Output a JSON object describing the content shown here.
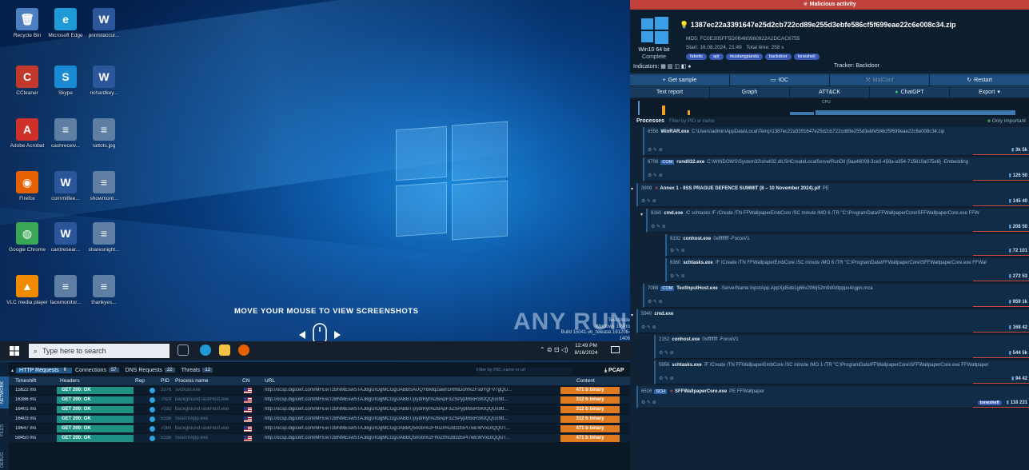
{
  "desktop": {
    "icons": [
      {
        "label": "Recycle Bin",
        "color": "#4b7fbf",
        "glyph": "🗑"
      },
      {
        "label": "Microsoft Edge",
        "color": "#1f9ad6",
        "glyph": "e"
      },
      {
        "label": "printstaccur...",
        "color": "#2b579a",
        "glyph": "W"
      },
      {
        "label": "CCleaner",
        "color": "#c0392b",
        "glyph": "C"
      },
      {
        "label": "Skype",
        "color": "#1a8ad4",
        "glyph": "S"
      },
      {
        "label": "richardkey...",
        "color": "#2b579a",
        "glyph": "W"
      },
      {
        "label": "Adobe Acrobat",
        "color": "#d0302a",
        "glyph": "A"
      },
      {
        "label": "cashreceiv...",
        "color": "#5e7ea3",
        "glyph": "≡"
      },
      {
        "label": "rattots.jpg",
        "color": "#5e7ea3",
        "glyph": "≡"
      },
      {
        "label": "Firefox",
        "color": "#e66000",
        "glyph": "◉"
      },
      {
        "label": "commitfee...",
        "color": "#2b579a",
        "glyph": "W"
      },
      {
        "label": "showmont...",
        "color": "#5e7ea3",
        "glyph": "≡"
      },
      {
        "label": "Google Chrome",
        "color": "#3aa757",
        "glyph": "◍"
      },
      {
        "label": "cardresear...",
        "color": "#2b579a",
        "glyph": "W"
      },
      {
        "label": "sharesnight...",
        "color": "#5e7ea3",
        "glyph": "≡"
      },
      {
        "label": "VLC media player",
        "color": "#f08a00",
        "glyph": "▲"
      },
      {
        "label": "facemonitor...",
        "color": "#5e7ea3",
        "glyph": "≡"
      },
      {
        "label": "thankyes...",
        "color": "#5e7ea3",
        "glyph": "≡"
      }
    ],
    "overlay_text": "MOVE YOUR MOUSE TO VIEW SCREENSHOTS",
    "watermark": "ANY RUN",
    "test_mode": [
      "Test Mode",
      "Windows 10 Pro",
      "Build 15041.vb_release.191206-1406"
    ],
    "taskbar": {
      "search_placeholder": "Type here to search",
      "time": "12:49 PM",
      "date": "8/16/2024"
    }
  },
  "analysis": {
    "banner": "Malicious activity",
    "filename": "1387ec22a3391647e25d2cb722cd89e255d3ebfe586cf5f699eae22c6e008c34.zip",
    "md5": "MD5: FC0E305FF5D0B480960922A2DCAC6755",
    "start": "Start: 16.08.2024, 21:49",
    "total_time": "Total time: 258 s",
    "os": "Win10 64 bit",
    "os_status": "Complete",
    "tags": [
      "faketls",
      "apt",
      "mustangpanda",
      "backdoor",
      "toneshell"
    ],
    "indicators_label": "Indicators:",
    "tracker": "Tracker: Backdoor",
    "buttons1": [
      "Get sample",
      "IOC",
      "MalConf",
      "Restart"
    ],
    "buttons2": [
      "Text report",
      "Graph",
      "ATT&CK",
      "ChatGPT",
      "Export"
    ],
    "cpu_label": "CPU",
    "processes_label": "Processes",
    "proc_filter_placeholder": "Filter by PID or name",
    "only_important": "Only important"
  },
  "processes": [
    {
      "pid": "6556",
      "badge": "",
      "name": "WinRAR.exe",
      "cmd": "C:\\Users\\admin\\AppData\\Local\\Temp\\1387ec22a3391647e25d2cb722cd89e255d3ebfe586cf5f699eae22c6e008c34.zip",
      "stats": "3k  5k",
      "tag": ""
    },
    {
      "pid": "6708",
      "badge": "COM",
      "name": "rundll32.exe",
      "cmd": "C:\\WINDOWS\\System32\\shell32.dll,SHCreateLocalServerRunDll {9aa46009-3ce0-458a-a354-715610a075e6} -Embedding",
      "stats": "126  50",
      "tag": ""
    },
    {
      "pid": "3908",
      "badge": "",
      "name": "Annex 1 - IISS PRAGUE DEFENCE SUMMIT (8 – 10 November 2024).pif",
      "cmd": "PE",
      "stats": "145  40",
      "tag": ""
    },
    {
      "pid": "6160",
      "badge": "",
      "name": "cmd.exe",
      "cmd": "/C schtasks /F /Create /TN FFWallpaperEmbCore /SC minute /MO 6 /TR \"C:\\ProgramData\\FFWallpaperCore\\SFFWallpaperCore.exe FFW",
      "stats": "208  50",
      "tag": ""
    },
    {
      "pid": "6192",
      "badge": "",
      "name": "conhost.exe",
      "cmd": "0xffffffff -ForceV1",
      "stats": "72  101",
      "tag": ""
    },
    {
      "pid": "6360",
      "badge": "",
      "name": "schtasks.exe",
      "cmd": "/F /Create /TN FFWallpaperEmbCore /SC minute /MO 6 /TR \"C:\\ProgramData\\FFWallpaperCore\\SFFWallpaperCore.exe FFWal",
      "stats": "272  53",
      "tag": ""
    },
    {
      "pid": "7088",
      "badge": "COM",
      "name": "TextInputHost.exe",
      "cmd": "-ServerName:InputApp.AppXjd5de1g66v206tj52m9d0dtpppx4cgpn.mca",
      "stats": "959  1k",
      "tag": ""
    },
    {
      "pid": "5940",
      "badge": "",
      "name": "cmd.exe",
      "cmd": "",
      "stats": "168  42",
      "tag": ""
    },
    {
      "pid": "2152",
      "badge": "",
      "name": "conhost.exe",
      "cmd": "0xffffffff -ForceV1",
      "stats": "544  5k",
      "tag": ""
    },
    {
      "pid": "5956",
      "badge": "",
      "name": "schtasks.exe",
      "cmd": "/F /Create /TN FFWallpaperEmbCore /SC minute /MO 1 /TR \"C:\\ProgramData\\FFWallpaperCore\\SFFWallpaperCore.exe FFWallpaper",
      "stats": "94  42",
      "tag": ""
    },
    {
      "pid": "6516",
      "badge": "SCH",
      "name": "SFFWallpaperCore.exe",
      "cmd": "PE  FFWallpaper",
      "stats": "118  231",
      "tag": "toneshell"
    }
  ],
  "network": {
    "tabs": [
      {
        "label": "HTTP Requests",
        "count": "6"
      },
      {
        "label": "Connections",
        "count": "57"
      },
      {
        "label": "DNS Requests",
        "count": "22"
      },
      {
        "label": "Threats",
        "count": "12"
      }
    ],
    "filter_placeholder": "Filter by PID, name or url",
    "pcap": "PCAP",
    "side_tabs": [
      "NETWORK",
      "FILES",
      "DEBUG"
    ],
    "columns": [
      "Timeshift",
      "Headers",
      "Rep",
      "PID",
      "Process name",
      "CN",
      "URL",
      "Content"
    ],
    "rows": [
      {
        "time": "15622 ms",
        "hdr": "GET  200: OK",
        "pid": "3376",
        "proc": "svchost.exe",
        "url": "http://ocsp.digicert.com/MFEwTzBNMEswSTAJBgUrDgMCGgUABBSAUQYBMq2awn1Rh6Doh%2FsBYgFV7gQU...",
        "content": "471 b  binary"
      },
      {
        "time": "16386 ms",
        "hdr": "GET  200: OK",
        "pid": "7024",
        "proc": "backgroundTaskHost.exe",
        "url": "http://ocsp.digicert.com/MFEwTzBNMEswSTAJBgUrDgMCGgUABBT/jryd/Ryt%2BApF3ZSPypf/BxRSKtQQUx9tt...",
        "content": "312 b  binary"
      },
      {
        "time": "16401 ms",
        "hdr": "GET  200: OK",
        "pid": "7032",
        "proc": "backgroundTaskHost.exe",
        "url": "http://ocsp.digicert.com/MFEwTzBNMEswSTAJBgUrDgMCGgUABBT/jryd/Ryt%2BApF3ZSPypf/BxRSKtQQUx9tt...",
        "content": "312 b  binary"
      },
      {
        "time": "16403 ms",
        "hdr": "GET  200: OK",
        "pid": "5336",
        "proc": "SearchApp.exe",
        "url": "http://ocsp.digicert.com/MFEwTzBNMEswSTAJBgUrDgMCGgUABBT/jryd/Ryt%2BApF3ZSPypf/BxRSKtQQUx9tt...",
        "content": "312 b  binary"
      },
      {
        "time": "19647 ms",
        "hdr": "GET  200: OK",
        "pid": "7060",
        "proc": "backgroundTaskHost.exe",
        "url": "http://ocsp.digicert.com/MFEwTzBNMEswSTAJBgUrDgMCGgUABBQ50otx%2Fh0Ztl%2BzdSPI7wEWVxDIQQUT...",
        "content": "471 b  binary"
      },
      {
        "time": "58450 ms",
        "hdr": "GET  200: OK",
        "pid": "5336",
        "proc": "SearchApp.exe",
        "url": "http://ocsp.digicert.com/MFEwTzBNMEswSTAJBgUrDgMCGgUABBQ50otx%2Fh0Ztl%2BzdSPI7wEWVxDIQQUT...",
        "content": "471 b  binary"
      }
    ]
  }
}
